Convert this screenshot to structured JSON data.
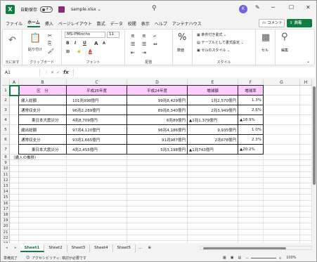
{
  "titlebar": {
    "autosave_label": "自動保存",
    "autosave_state": "オフ",
    "filename": "sample.xlsx",
    "filename_chevron": "⌄",
    "user_initial": "K"
  },
  "menu": [
    "ファイル",
    "ホーム",
    "挿入",
    "ページレイアウト",
    "数式",
    "データ",
    "校閲",
    "表示",
    "ヘルプ",
    "アンテナハウス"
  ],
  "active_menu": "ホーム",
  "comment_label": "コメント",
  "share_label": "共有",
  "ribbon": {
    "undo_label": "元に戻す",
    "paste_label": "貼り付け",
    "clipboard_label": "クリップボード",
    "font_name": "MS-PMincho",
    "font_size": "11",
    "font_label": "フォント",
    "align_label": "配置",
    "number_label": "数値",
    "cond_format_label": "条件付き書式",
    "table_format_label": "テーブルとして書式設定",
    "cell_style_label": "セルのスタイル",
    "style_label": "スタイル",
    "cell_label": "セル",
    "edit_label": "編集"
  },
  "formula_bar": {
    "name_box": "A1",
    "fx": "fx",
    "value": ""
  },
  "columns": [
    "A",
    "B",
    "C",
    "D",
    "E",
    "F",
    "G",
    "H"
  ],
  "rows": [
    "1",
    "2",
    "3",
    "4",
    "5",
    "6",
    "7",
    "8",
    "9",
    "10",
    "11",
    "12",
    "13",
    "14",
    "15",
    "16",
    "17",
    "18",
    "19",
    "20",
    "21",
    "22",
    "23",
    "24",
    "25",
    "26",
    "27",
    "28"
  ],
  "table": {
    "header": [
      "区　分",
      "平成25年度",
      "平成24年度",
      "増減額",
      "増減率"
    ],
    "rows": [
      {
        "label": "歳入総額",
        "indent": false,
        "c": "101兆998億円",
        "d": "99兆8,429億円",
        "e": "1兆2,570億円",
        "f": "1.3%"
      },
      {
        "label": "通常収支分",
        "indent": false,
        "c": "96兆2,289億円",
        "d": "89兆8,340億円",
        "e": "2兆3,949億円",
        "f": "2.6%"
      },
      {
        "label": "東日本大震災分",
        "indent": true,
        "c": "4兆8,709億円",
        "d": "6兆89億円",
        "e": "▲1兆1,379億円",
        "f": "▲18.9%"
      },
      {
        "label": "歳出総額",
        "indent": false,
        "c": "97兆4,120億円",
        "d": "96兆4,186億円",
        "e": "9,935億円",
        "f": "1.0%"
      },
      {
        "label": "通常収支分",
        "indent": false,
        "c": "93兆1,665億円",
        "d": "91兆987億円",
        "e": "2兆678億円",
        "f": "2.3%"
      },
      {
        "label": "東日本大震災分",
        "indent": true,
        "c": "4兆2,455億円",
        "d": "5兆3,198億円",
        "e": "▲1兆743億円",
        "f": "▲20.2%"
      }
    ]
  },
  "note_text": "（歳入の推移）",
  "sheets": [
    "Sheet1",
    "Sheet2",
    "Sheet3",
    "Sheet4",
    "Sheet5"
  ],
  "active_sheet": "Sheet1",
  "status": {
    "ready": "準備完了",
    "accessibility": "アクセシビリティ: 検討が必要です",
    "zoom": "100%"
  },
  "colors": {
    "accent": "#107c41",
    "header_fill": "#ffccff"
  }
}
